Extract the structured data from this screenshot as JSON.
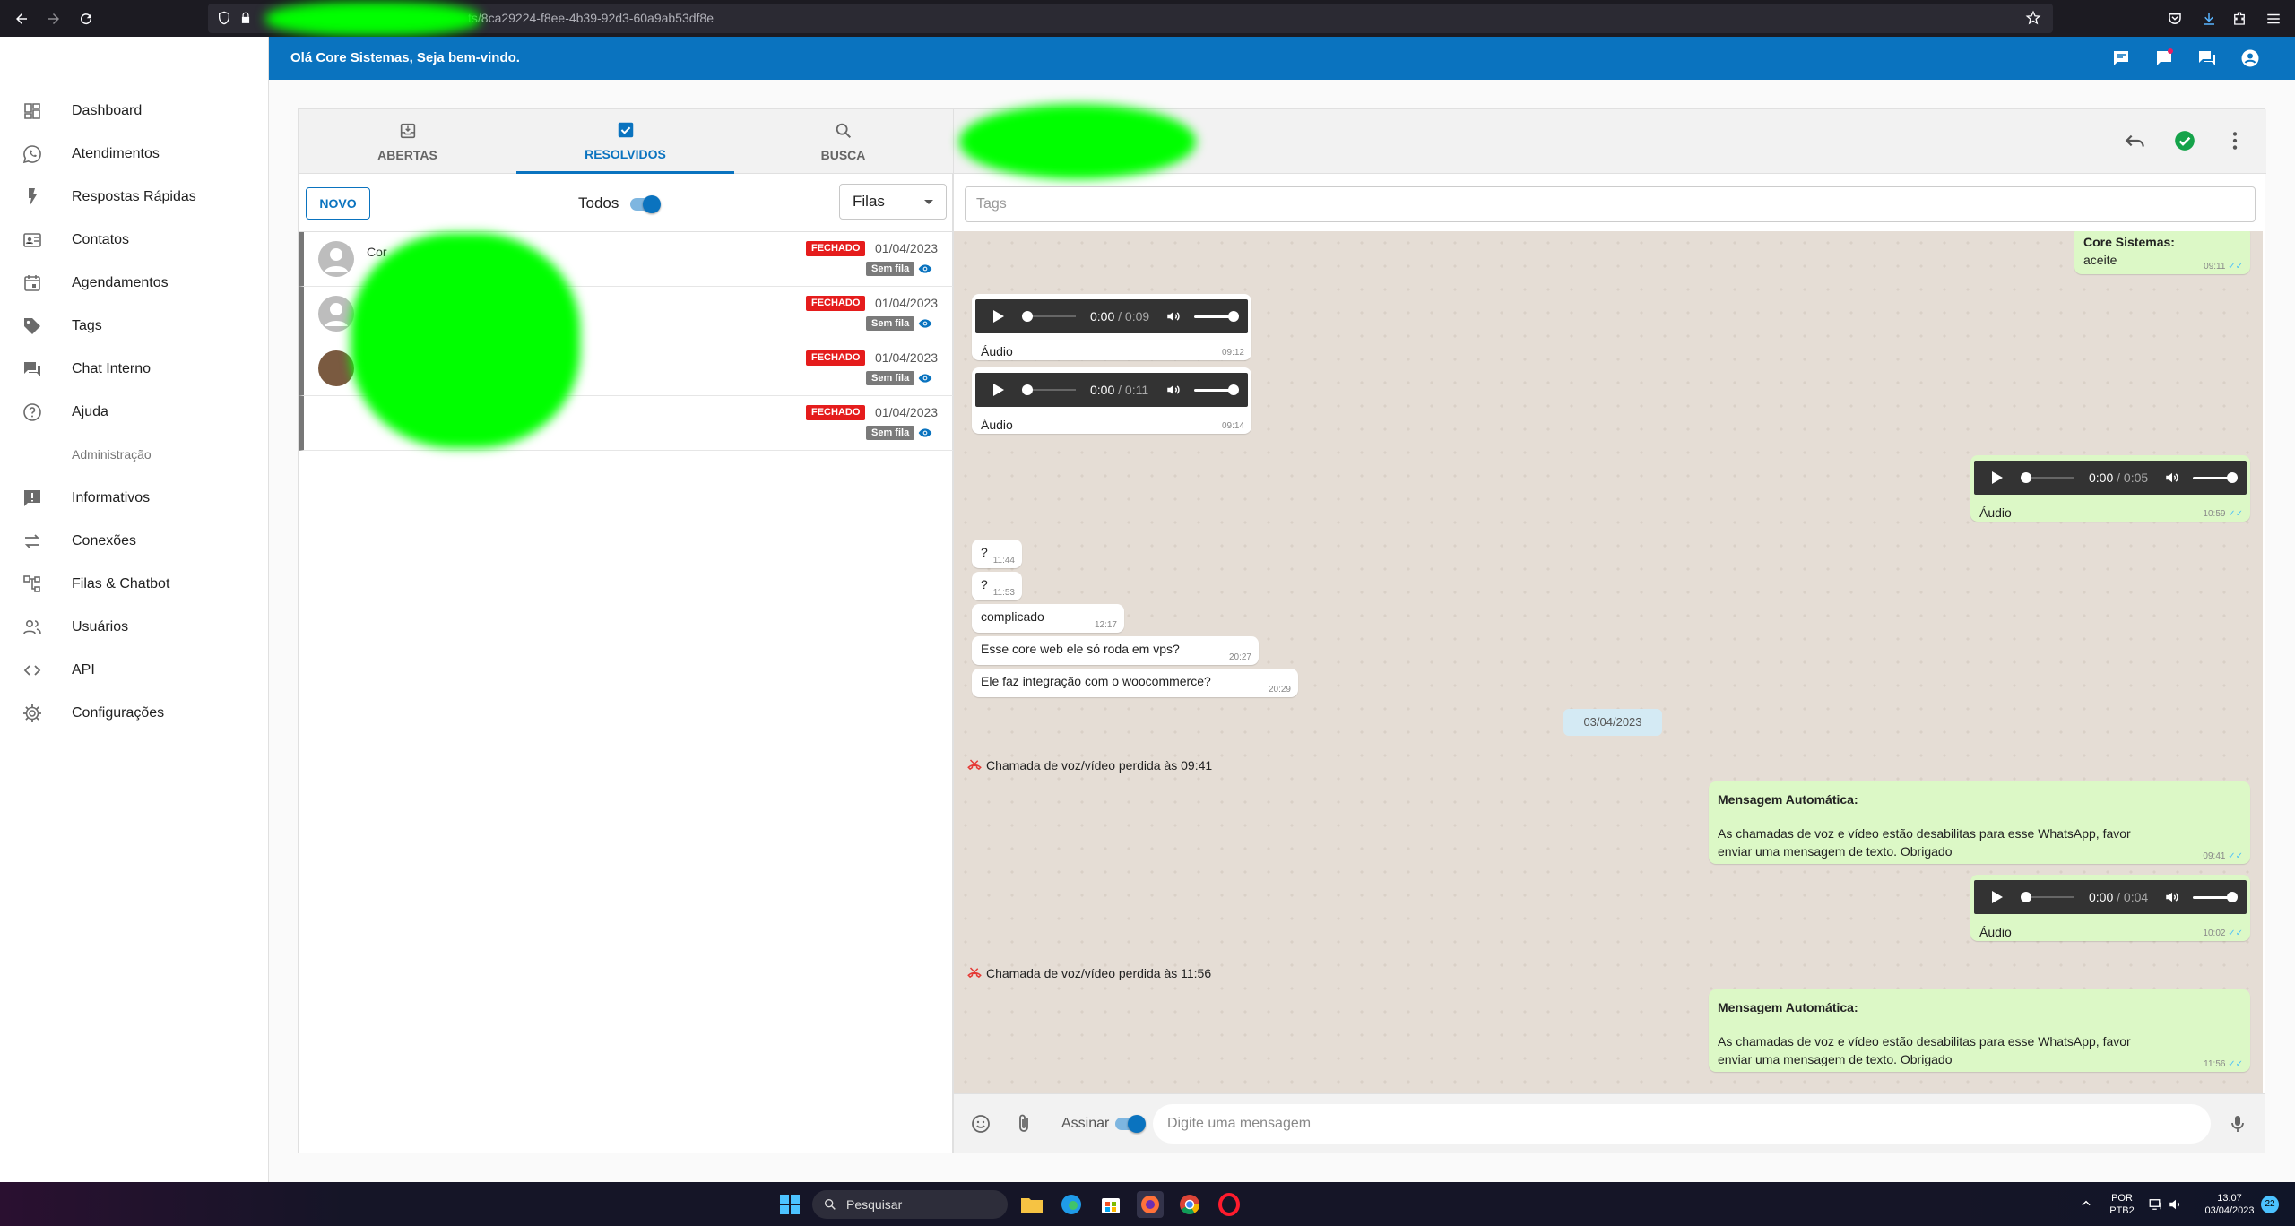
{
  "browser": {
    "url": "ts/8ca29224-f8ee-4b39-92d3-60a9ab53df8e"
  },
  "sidebar": {
    "items": [
      {
        "label": "Dashboard",
        "icon": "dashboard-icon"
      },
      {
        "label": "Atendimentos",
        "icon": "whatsapp-icon"
      },
      {
        "label": "Respostas Rápidas",
        "icon": "flash-icon"
      },
      {
        "label": "Contatos",
        "icon": "contacts-icon"
      },
      {
        "label": "Agendamentos",
        "icon": "calendar-icon"
      },
      {
        "label": "Tags",
        "icon": "tag-icon"
      },
      {
        "label": "Chat Interno",
        "icon": "forum-icon"
      },
      {
        "label": "Ajuda",
        "icon": "help-icon"
      }
    ],
    "admin_title": "Administração",
    "admin_items": [
      {
        "label": "Informativos",
        "icon": "announcement-icon"
      },
      {
        "label": "Conexões",
        "icon": "sync-alt-icon"
      },
      {
        "label": "Filas & Chatbot",
        "icon": "account-tree-icon"
      },
      {
        "label": "Usuários",
        "icon": "people-icon"
      },
      {
        "label": "API",
        "icon": "code-icon"
      },
      {
        "label": "Configurações",
        "icon": "settings-icon"
      }
    ]
  },
  "appbar": {
    "greeting_prefix": "Olá ",
    "greeting_name": "Core Sistemas",
    "greeting_suffix": ", Seja bem-vindo."
  },
  "tickets": {
    "tabs": [
      {
        "label": "ABERTAS",
        "icon": "move-to-inbox-icon"
      },
      {
        "label": "RESOLVIDOS",
        "icon": "check-box-icon"
      },
      {
        "label": "BUSCA",
        "icon": "search-icon"
      }
    ],
    "new_button": "NOVO",
    "filter_label": "Todos",
    "queue_select": "Filas",
    "list": [
      {
        "name": "Cor",
        "status": "FECHADO",
        "date": "01/04/2023",
        "queue": "Sem fila"
      },
      {
        "name": "",
        "status": "FECHADO",
        "date": "01/04/2023",
        "queue": "Sem fila"
      },
      {
        "name": "",
        "status": "FECHADO",
        "date": "01/04/2023",
        "queue": "Sem fila"
      },
      {
        "name": "",
        "status": "FECHADO",
        "date": "01/04/2023",
        "queue": "Sem fila"
      }
    ]
  },
  "chat": {
    "tags_placeholder": "Tags",
    "messages": {
      "m1_sender": "Core Sistemas:",
      "m1_text": "aceite",
      "m1_time": "09:11",
      "a1_current": "0:00",
      "a1_duration": " / 0:09",
      "a1_label": "Áudio",
      "a1_time": "09:12",
      "a2_current": "0:00",
      "a2_duration": " / 0:11",
      "a2_label": "Áudio",
      "a2_time": "09:14",
      "a3_current": "0:00",
      "a3_duration": " / 0:05",
      "a3_label": "Áudio",
      "a3_time": "10:59",
      "q1_text": "?",
      "q1_time": "11:44",
      "q2_text": "?",
      "q2_time": "11:53",
      "c_text": "complicado",
      "c_time": "12:17",
      "v_text": "Esse core web ele só  roda em vps?",
      "v_time": "20:27",
      "w_text": "Ele faz integração  com o woocommerce?",
      "w_time": "20:29",
      "date_divider": "03/04/2023",
      "call1": "Chamada de voz/vídeo perdida às 09:41",
      "auto1_title": "Mensagem Automática:",
      "auto1_line1": "As chamadas de voz e vídeo estão desabilitas para esse WhatsApp, favor",
      "auto1_line2": "enviar uma mensagem de texto. Obrigado",
      "auto1_time": "09:41",
      "a4_current": "0:00",
      "a4_duration": " / 0:04",
      "a4_label": "Áudio",
      "a4_time": "10:02",
      "call2": "Chamada de voz/vídeo perdida às 11:56",
      "auto2_title": "Mensagem Automática:",
      "auto2_line1": "As chamadas de voz e vídeo estão desabilitas para esse WhatsApp, favor",
      "auto2_line2": "enviar uma mensagem de texto. Obrigado",
      "auto2_time": "11:56"
    },
    "sign_label": "Assinar",
    "input_placeholder": "Digite uma mensagem"
  },
  "taskbar": {
    "search": "Pesquisar",
    "lang_line1": "POR",
    "lang_line2": "PTB2",
    "time": "13:07",
    "date": "03/04/2023",
    "notifications": "22"
  },
  "colors": {
    "primary": "#0a73bf",
    "closed_badge": "#e51c1c",
    "outgoing_bubble": "#dcf8c6"
  }
}
